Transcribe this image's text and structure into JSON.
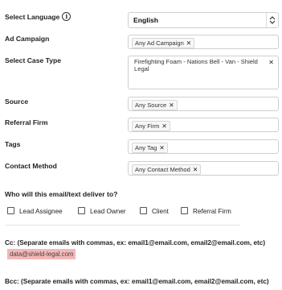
{
  "language": {
    "label": "Select Language",
    "value": "English"
  },
  "ad_campaign": {
    "label": "Ad Campaign",
    "tag": "Any Ad Campaign"
  },
  "case_type": {
    "label": "Select Case Type",
    "tag": "Firefighting Foam - Nations Bell - Van - Shield Legal"
  },
  "source": {
    "label": "Source",
    "tag": "Any Source"
  },
  "referral_firm": {
    "label": "Referral Firm",
    "tag": "Any Firm"
  },
  "tags": {
    "label": "Tags",
    "tag": "Any Tag"
  },
  "contact_method": {
    "label": "Contact Method",
    "tag": "Any Contact Method"
  },
  "delivery": {
    "question": "Who will this email/text deliver to?",
    "options": [
      "Lead Assignee",
      "Lead Owner",
      "Client",
      "Referral Firm"
    ]
  },
  "cc": {
    "label": "Cc: (Separate emails with commas, ex: email1@email.com, email2@email.com, etc)",
    "chip": "data@shield-legal.com"
  },
  "bcc": {
    "label": "Bcc: (Separate emails with commas, ex: email1@email.com, email2@email.com, etc)"
  },
  "icons": {
    "info": "info-icon",
    "remove": "close-icon",
    "select": "up-down-arrows-icon"
  },
  "colors": {
    "chip_bg": "#f4b7b7",
    "border": "#cfcfcf"
  }
}
